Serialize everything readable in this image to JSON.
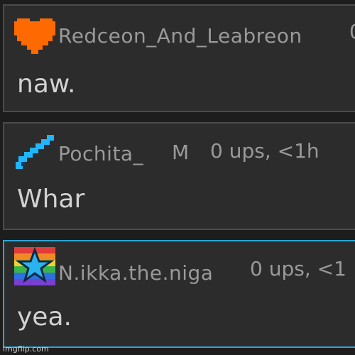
{
  "comments": [
    {
      "icon": "orange-heart-icon",
      "username": "Redceon_And_Leabreon",
      "badge": "",
      "meta": "0",
      "text": "naw."
    },
    {
      "icon": "blue-sword-icon",
      "username": "Pochita_",
      "badge": "M",
      "meta": "0 ups, <1h",
      "text": "Whar"
    },
    {
      "icon": "rainbow-star-icon",
      "username": "N.ikka.the.niga",
      "badge": "",
      "meta": "0 ups, <1",
      "text": "yea."
    }
  ],
  "watermark": "imgflip.com",
  "colors": {
    "background": "#1d1d1d",
    "card": "#2c2c2c",
    "card_border": "#4b4b4b",
    "highlight_border": "#2aa4d6",
    "heart": "#ff6a00",
    "sword": "#1fb6ff"
  }
}
